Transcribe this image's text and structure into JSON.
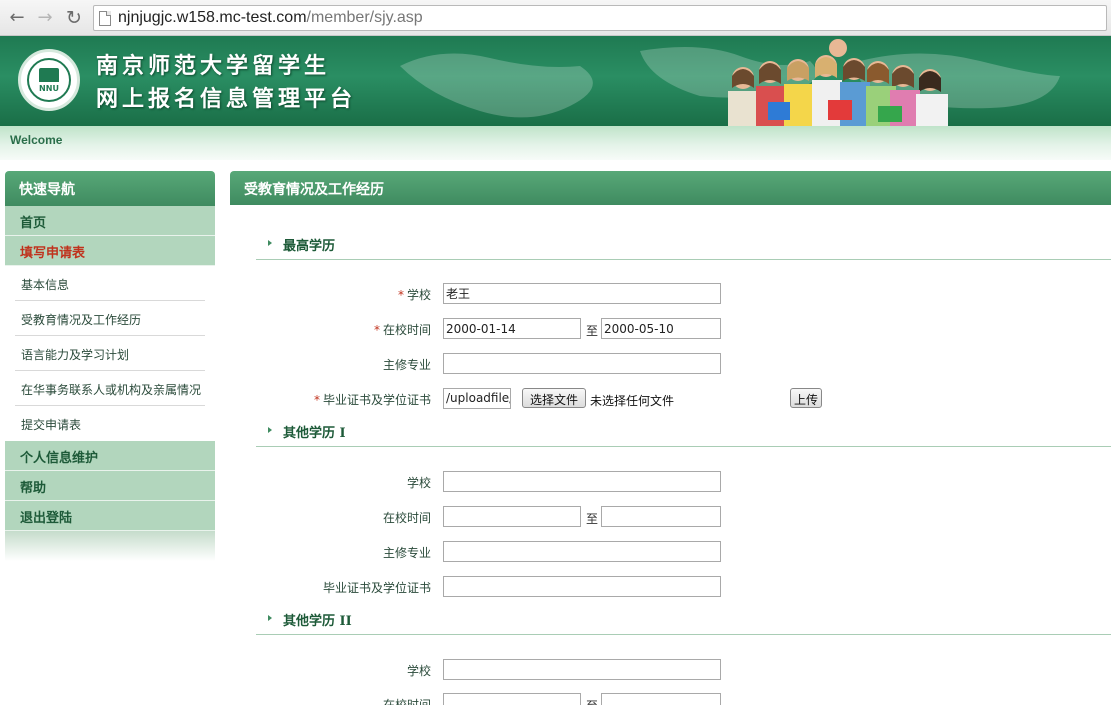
{
  "browser": {
    "url_host": "njnjugjc.w158.mc-test.com",
    "url_path": "/member/sjy.asp"
  },
  "banner": {
    "title_line1": "南京师范大学留学生",
    "title_line2": "网上报名信息管理平台",
    "logo_text": "NNU"
  },
  "welcome": "Welcome",
  "sidebar": {
    "header": "快速导航",
    "items": [
      {
        "label": "首页",
        "type": "main",
        "active": false
      },
      {
        "label": "填写申请表",
        "type": "main",
        "active": true
      },
      {
        "label": "基本信息",
        "type": "sub"
      },
      {
        "label": "受教育情况及工作经历",
        "type": "sub"
      },
      {
        "label": "语言能力及学习计划",
        "type": "sub"
      },
      {
        "label": "在华事务联系人或机构及亲属情况",
        "type": "sub"
      },
      {
        "label": "提交申请表",
        "type": "sub"
      },
      {
        "label": "个人信息维护",
        "type": "main",
        "active": false
      },
      {
        "label": "帮助",
        "type": "main",
        "active": false
      },
      {
        "label": "退出登陆",
        "type": "main",
        "active": false
      }
    ]
  },
  "main": {
    "header": "受教育情况及工作经历",
    "sections": [
      {
        "title": "最高学历",
        "school_label": "学校",
        "school_value": "老王",
        "period_label": "在校时间",
        "start_value": "2000-01-14",
        "end_value": "2000-05-10",
        "to_label": "至",
        "major_label": "主修专业",
        "major_value": "",
        "cert_label": "毕业证书及学位证书",
        "cert_path": "/uploadfile/",
        "choose_button": "选择文件",
        "no_file_text": "未选择任何文件",
        "upload_button": "上传"
      },
      {
        "title": "其他学历 I",
        "school_label": "学校",
        "period_label": "在校时间",
        "to_label": "至",
        "major_label": "主修专业",
        "cert_label": "毕业证书及学位证书"
      },
      {
        "title": "其他学历 II",
        "school_label": "学校",
        "period_label": "在校时间",
        "to_label": "至"
      }
    ],
    "required_mark": "*"
  }
}
